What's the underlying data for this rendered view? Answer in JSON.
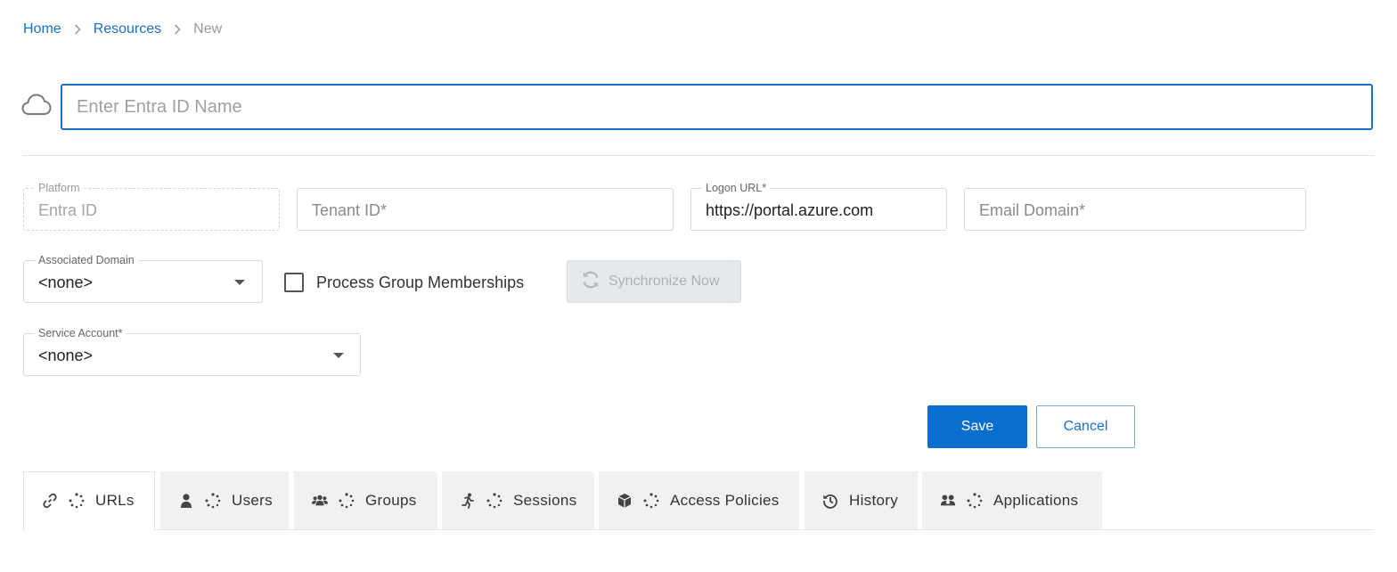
{
  "breadcrumb": {
    "home": "Home",
    "resources": "Resources",
    "current": "New"
  },
  "name_input": {
    "placeholder": "Enter Entra ID Name",
    "value": ""
  },
  "fields": {
    "platform": {
      "label": "Platform",
      "value": "Entra ID"
    },
    "tenant_id": {
      "placeholder": "Tenant ID*"
    },
    "logon_url": {
      "label": "Logon URL*",
      "value": "https://portal.azure.com"
    },
    "email_domain": {
      "placeholder": "Email Domain*"
    },
    "associated_domain": {
      "label": "Associated Domain",
      "value": "<none>"
    },
    "service_account": {
      "label": "Service Account*",
      "value": "<none>"
    }
  },
  "process_group_memberships": {
    "label": "Process Group Memberships",
    "checked": false
  },
  "sync_button": {
    "label": "Synchronize Now",
    "enabled": false
  },
  "actions": {
    "save": "Save",
    "cancel": "Cancel"
  },
  "tabs": [
    {
      "label": "URLs",
      "icon": "link-icon",
      "active": true
    },
    {
      "label": "Users",
      "icon": "user-icon",
      "active": false
    },
    {
      "label": "Groups",
      "icon": "users-icon",
      "active": false
    },
    {
      "label": "Sessions",
      "icon": "running-person-icon",
      "active": false
    },
    {
      "label": "Access Policies",
      "icon": "cube-icon",
      "active": false
    },
    {
      "label": "History",
      "icon": "history-icon",
      "active": false
    },
    {
      "label": "Applications",
      "icon": "apps-icon",
      "active": false
    }
  ],
  "colors": {
    "accent": "#0a6ed1",
    "link": "#1a6fc9",
    "tab_bg": "#eff1f3"
  }
}
